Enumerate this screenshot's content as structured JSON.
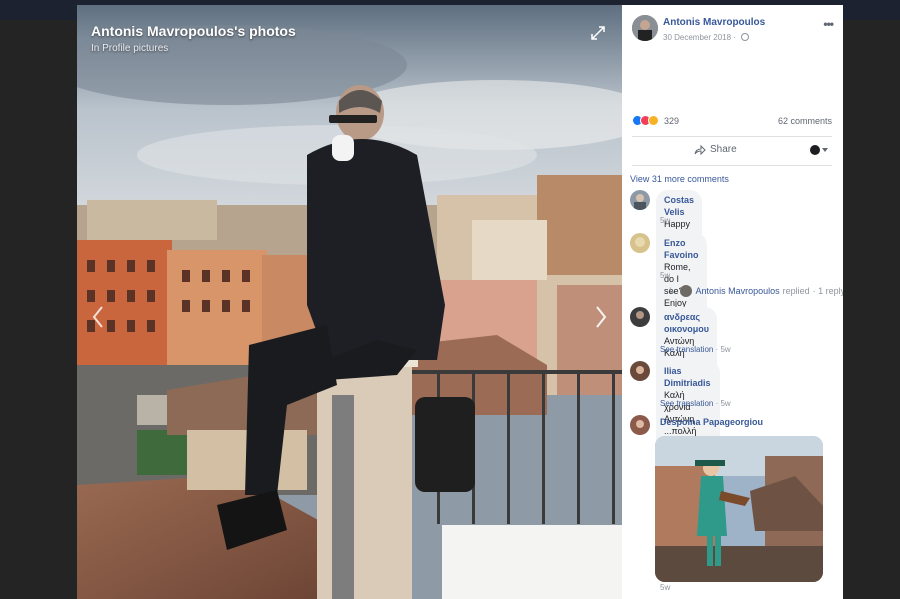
{
  "viewer": {
    "title": "Antonis Mavropoulos's photos",
    "subtitle": "In Profile pictures"
  },
  "post": {
    "author": "Antonis Mavropoulos",
    "date": "30 December 2018 · ",
    "reaction_count": "329",
    "comments_count": "62 comments",
    "share_label": "Share"
  },
  "comments_section": {
    "view_more": "View 31 more comments",
    "comments": [
      {
        "name": "Costas Velis",
        "text": " Happy new year!",
        "meta": "5w"
      },
      {
        "name": "Enzo Favoino",
        "text": " Rome, do I see?",
        "text2": "Enjoy your stay, and have a great 2019",
        "meta": "5w"
      },
      {
        "name": "ανδρεας οικονομου",
        "text": " Αντώνη Καλή χρονιά",
        "text2": "!!!!!!",
        "meta_link": "See translation",
        "meta": " · 5w"
      },
      {
        "name": "Ilias Dimitriadis",
        "text": " Καλή χρονιά Αντώνη",
        "text2": "...πολλή δημιουργική με υγεία...",
        "meta_link": "See translation",
        "meta": " · 5w"
      },
      {
        "name": "Despoina Papageorgiou",
        "meta": "5w"
      }
    ],
    "reply": {
      "name": "Antonis Mavropoulos",
      "action": "replied",
      "count": "· 1 reply"
    }
  },
  "colors": {
    "link": "#385898",
    "like": "#1877f2",
    "love": "#f33e58",
    "wow": "#f7b125"
  },
  "icons": [
    "expand-icon",
    "chevron-left-icon",
    "chevron-right-icon",
    "globe-icon",
    "more-options-icon",
    "share-icon",
    "audience-icon"
  ]
}
